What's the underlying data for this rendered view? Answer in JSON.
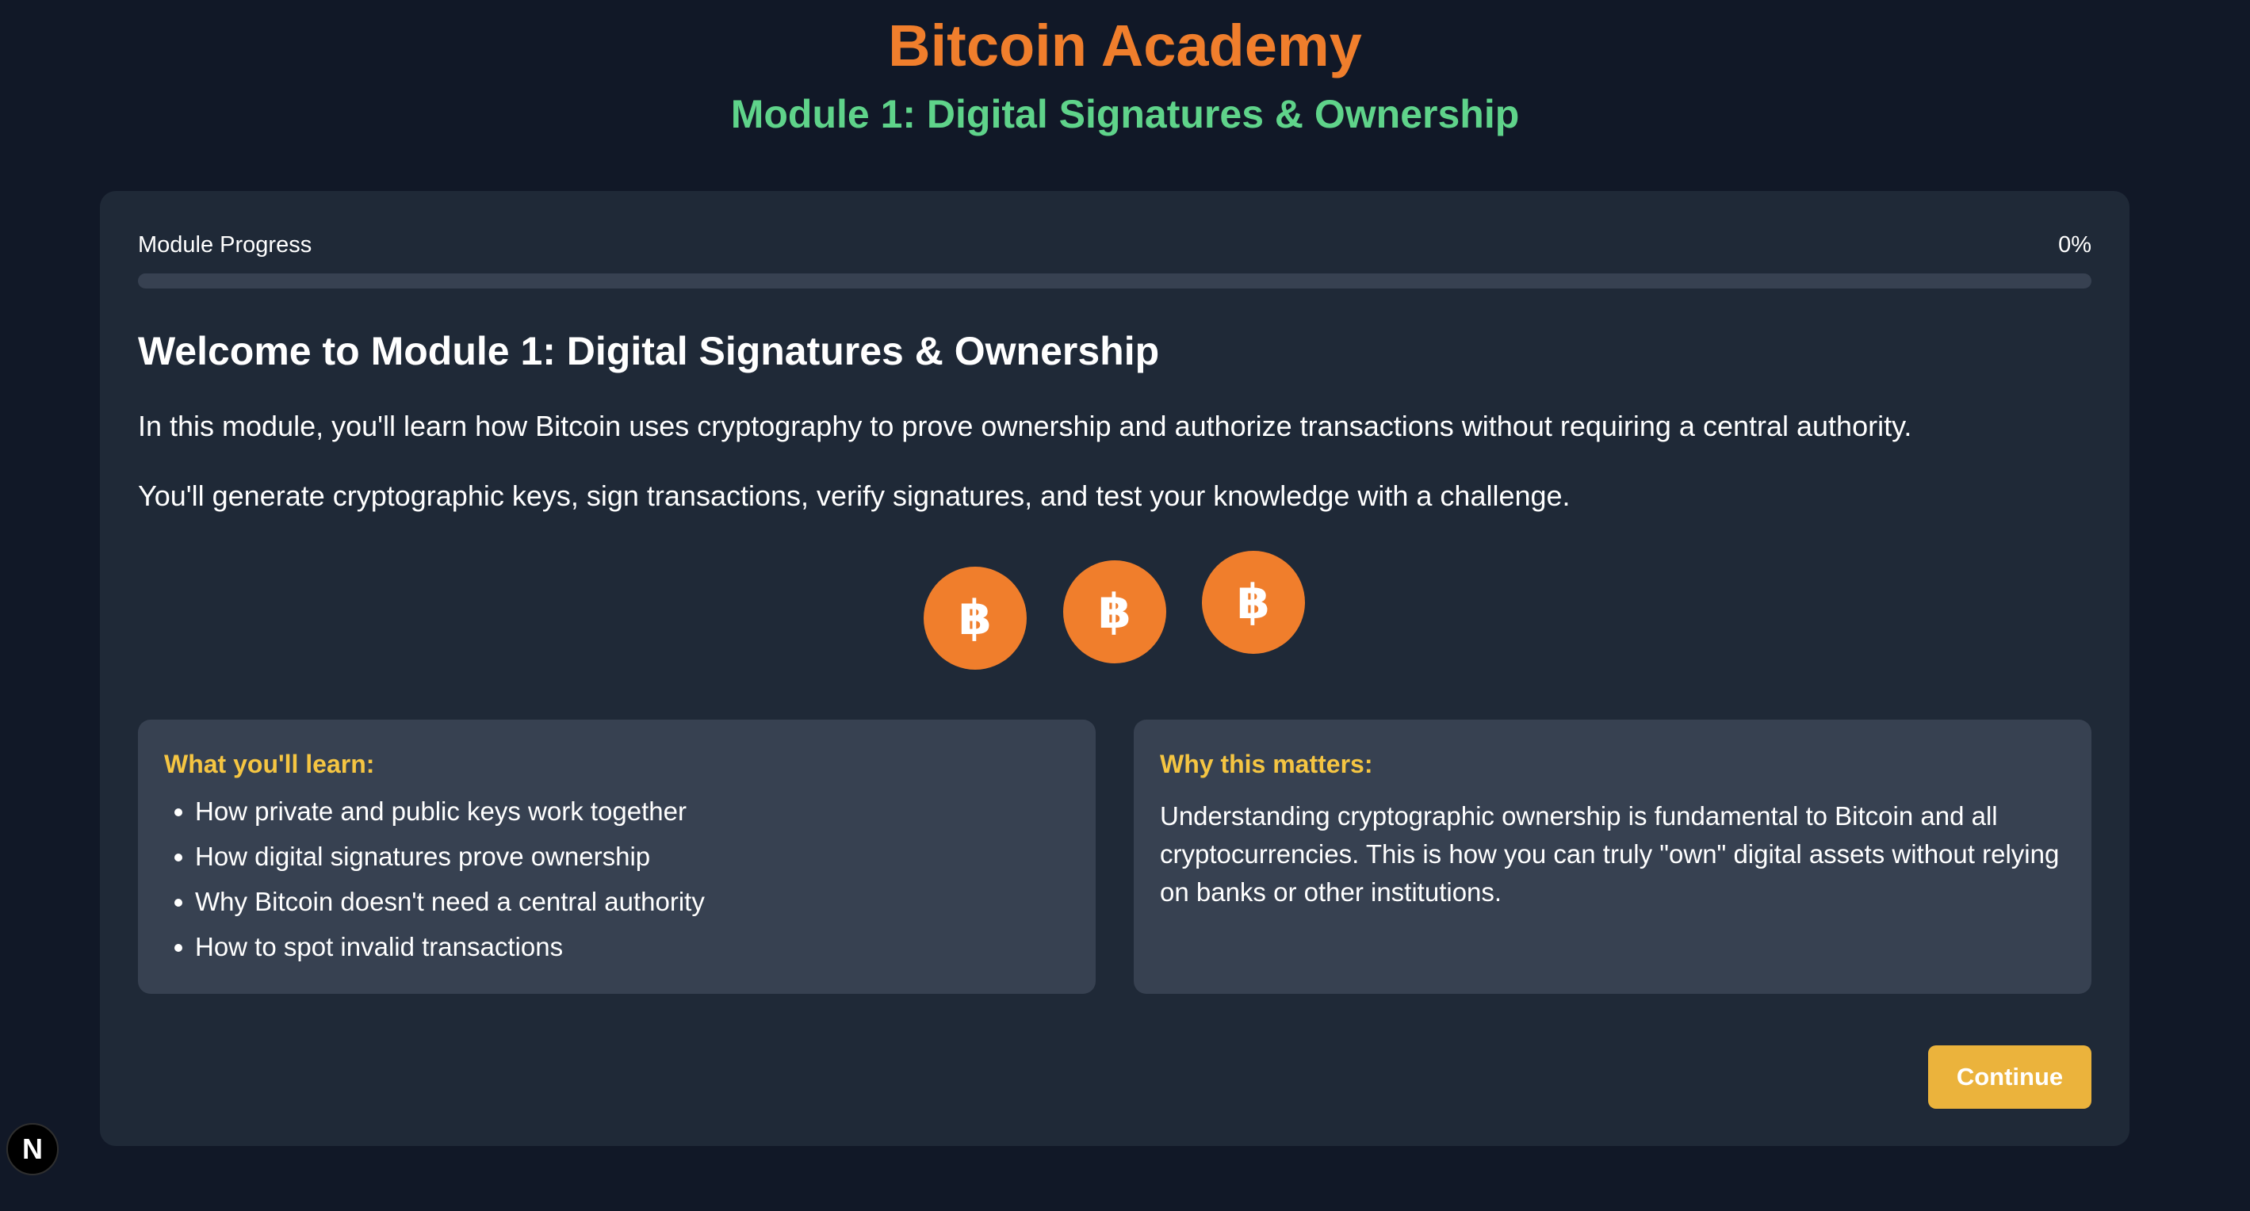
{
  "header": {
    "title": "Bitcoin Academy",
    "subtitle": "Module 1: Digital Signatures & Ownership"
  },
  "progress": {
    "label": "Module Progress",
    "value_text": "0%",
    "fraction": 0
  },
  "welcome": {
    "heading": "Welcome to Module 1: Digital Signatures & Ownership",
    "paragraphs": [
      "In this module, you'll learn how Bitcoin uses cryptography to prove ownership and authorize transactions without requiring a central authority.",
      "You'll generate cryptographic keys, sign transactions, verify signatures, and test your knowledge with a challenge."
    ]
  },
  "coins": {
    "symbol": "฿",
    "icon_name": "bitcoin-icon",
    "count": 3,
    "color": "#f07e2c"
  },
  "learn_box": {
    "heading": "What you'll learn:",
    "items": [
      "How private and public keys work together",
      "How digital signatures prove ownership",
      "Why Bitcoin doesn't need a central authority",
      "How to spot invalid transactions"
    ]
  },
  "why_box": {
    "heading": "Why this matters:",
    "text": "Understanding cryptographic ownership is fundamental to Bitcoin and all cryptocurrencies. This is how you can truly \"own\" digital assets without relying on banks or other institutions."
  },
  "actions": {
    "continue_label": "Continue"
  },
  "badge": {
    "letter": "N",
    "icon_name": "nextjs-icon"
  },
  "colors": {
    "background": "#111827",
    "card": "#1f2937",
    "box": "#374151",
    "brand_orange": "#f07e2c",
    "accent_green": "#5fd38a",
    "heading_yellow": "#f5c542",
    "button_yellow": "#ebb33c"
  }
}
